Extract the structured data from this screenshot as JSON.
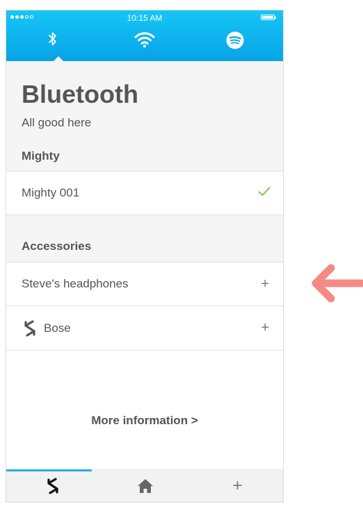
{
  "statusbar": {
    "time": "10:15 AM",
    "signal_dots": 5,
    "signal_filled": 3
  },
  "colors": {
    "topbar": "#0aa9e8",
    "accent": "#1fb0e3",
    "check": "#7ec84a",
    "arrow": "#f58a84",
    "text": "#555555"
  },
  "top_tabs": [
    {
      "icon": "bluetooth-icon",
      "selected": true
    },
    {
      "icon": "wifi-icon",
      "selected": false
    },
    {
      "icon": "spotify-icon",
      "selected": false
    }
  ],
  "page": {
    "title": "Bluetooth",
    "subtitle": "All good here"
  },
  "sections": {
    "mighty": {
      "header": "Mighty",
      "items": [
        {
          "label": "Mighty 001",
          "status_icon": "checkmark-icon"
        }
      ]
    },
    "accessories": {
      "header": "Accessories",
      "items": [
        {
          "label": "Steve's headphones",
          "action": "+",
          "icon": ""
        },
        {
          "label": "Bose",
          "action": "+",
          "icon": "mighty-logo-icon"
        }
      ]
    }
  },
  "more_info": "More information >",
  "bottom_tabs": [
    {
      "icon": "mighty-logo-icon",
      "selected": true
    },
    {
      "icon": "home-icon",
      "selected": false
    },
    {
      "icon": "add-icon",
      "selected": false,
      "label": "+"
    }
  ],
  "annotation": {
    "icon": "arrow-left-icon"
  }
}
